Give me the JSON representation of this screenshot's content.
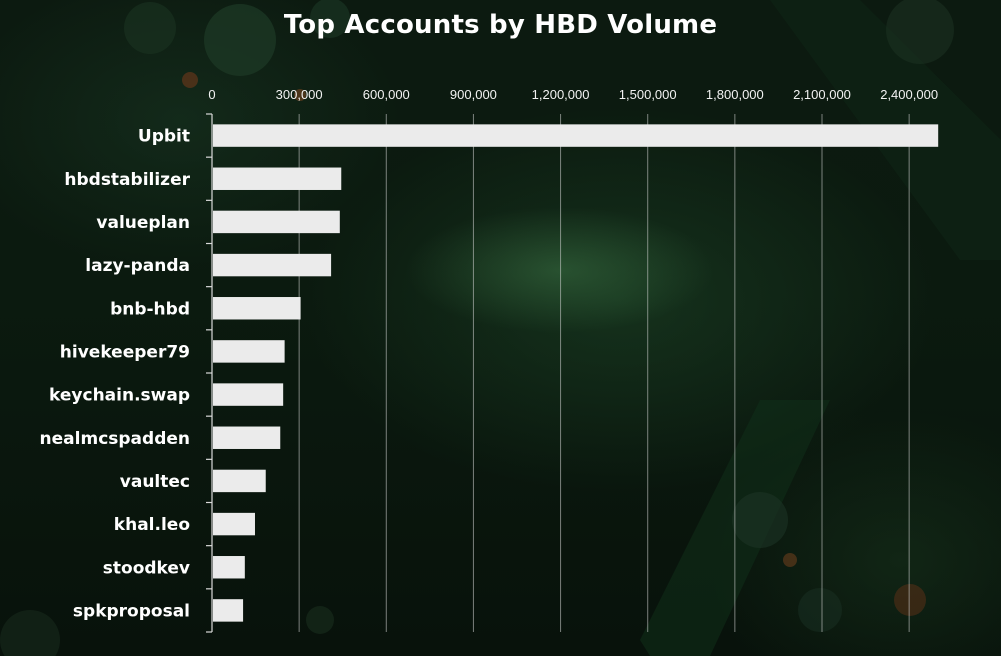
{
  "chart_data": {
    "type": "bar",
    "orientation": "horizontal",
    "title": "Top Accounts by HBD Volume",
    "xlabel": "",
    "ylabel": "",
    "xlim": [
      0,
      2520000
    ],
    "x_ticks": [
      0,
      300000,
      600000,
      900000,
      1200000,
      1500000,
      1800000,
      2100000,
      2400000
    ],
    "x_tick_labels": [
      "0",
      "300,000",
      "600,000",
      "900,000",
      "1,200,000",
      "1,500,000",
      "1,800,000",
      "2,100,000",
      "2,400,000"
    ],
    "x_axis_position": "top",
    "grid": true,
    "legend": "none",
    "categories": [
      "Upbit",
      "hbdstabilizer",
      "valueplan",
      "lazy-panda",
      "bnb-hbd",
      "hivekeeper79",
      "keychain.swap",
      "nealmcspadden",
      "vaultec",
      "khal.leo",
      "stoodkev",
      "spkproposal"
    ],
    "values": [
      2500000,
      445000,
      440000,
      410000,
      305000,
      250000,
      245000,
      235000,
      185000,
      148000,
      113000,
      107000
    ],
    "bar_color": "#ebebeb",
    "text_color": "#ffffff"
  }
}
